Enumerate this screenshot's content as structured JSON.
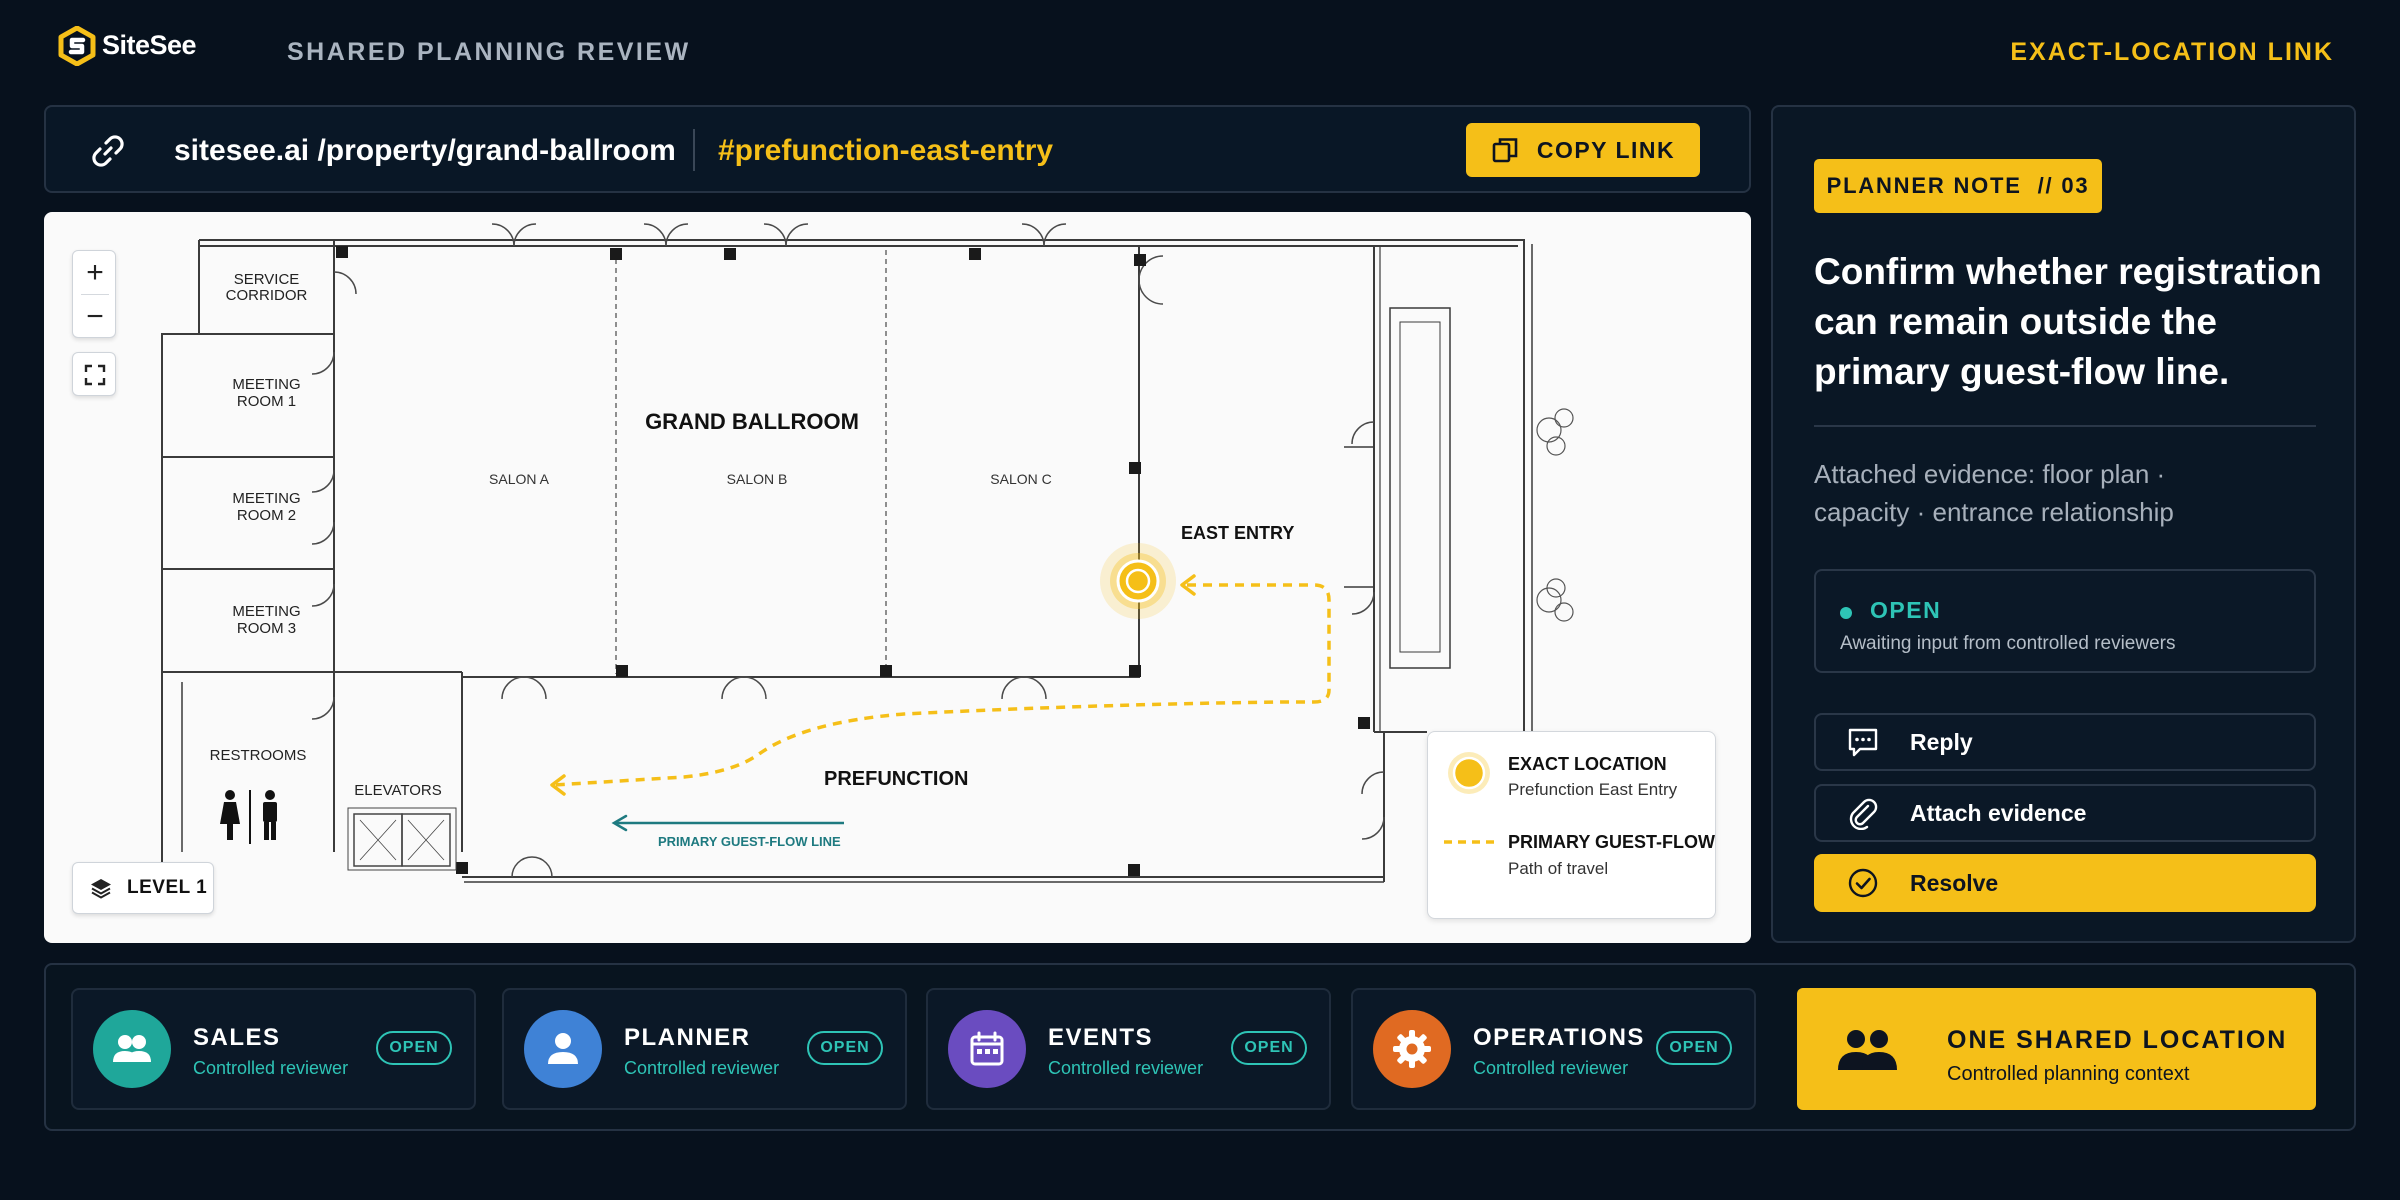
{
  "app": {
    "brand": "SiteSee",
    "page_title": "SHARED PLANNING REVIEW",
    "mode_label": "EXACT-LOCATION LINK"
  },
  "urlbar": {
    "base": "sitesee.ai /property/grand-ballroom",
    "hash": "#prefunction-east-entry",
    "copy_label": "COPY LINK"
  },
  "map": {
    "rooms": {
      "service": [
        "SERVICE",
        "CORRIDOR"
      ],
      "meeting1": [
        "MEETING",
        "ROOM 1"
      ],
      "meeting2": [
        "MEETING",
        "ROOM 2"
      ],
      "meeting3": [
        "MEETING",
        "ROOM 3"
      ],
      "restrooms": "RESTROOMS",
      "elevators": "ELEVATORS",
      "ballroom": "GRAND BALLROOM",
      "salon_a": "SALON A",
      "salon_b": "SALON B",
      "salon_c": "SALON C",
      "prefunction": "PREFUNCTION",
      "east_entry": "EAST ENTRY",
      "flow_line": "PRIMARY GUEST-FLOW LINE"
    },
    "zoom_in": "+",
    "zoom_out": "−",
    "level": "LEVEL 1",
    "legend": {
      "exact_title": "EXACT LOCATION",
      "exact_sub": "Prefunction East Entry",
      "flow_title": "PRIMARY GUEST-FLOW",
      "flow_sub": "Path of travel"
    },
    "colors": {
      "accent": "#f5bf18",
      "flow_arrow": "#1e7a80"
    }
  },
  "panel": {
    "badge": "PLANNER NOTE  // 03",
    "title_lines": [
      "Confirm whether registration",
      "can remain outside the",
      "primary guest-flow line."
    ],
    "evidence_lines": [
      "Attached evidence: floor plan ·",
      "capacity · entrance relationship"
    ],
    "status": {
      "label": "OPEN",
      "sub": "Awaiting input from controlled reviewers"
    },
    "actions": {
      "reply": "Reply",
      "attach": "Attach evidence",
      "resolve": "Resolve"
    }
  },
  "reviewers": [
    {
      "name": "SALES",
      "role": "Controlled reviewer",
      "status": "OPEN",
      "color": "#1fa79a",
      "icon": "people-icon"
    },
    {
      "name": "PLANNER",
      "role": "Controlled reviewer",
      "status": "OPEN",
      "color": "#3f82d6",
      "icon": "person-icon"
    },
    {
      "name": "EVENTS",
      "role": "Controlled reviewer",
      "status": "OPEN",
      "color": "#6a4cc0",
      "icon": "calendar-icon"
    },
    {
      "name": "OPERATIONS",
      "role": "Controlled reviewer",
      "status": "OPEN",
      "color": "#e06a22",
      "icon": "gear-icon"
    }
  ],
  "shared": {
    "title": "ONE SHARED LOCATION",
    "sub": "Controlled planning context"
  }
}
